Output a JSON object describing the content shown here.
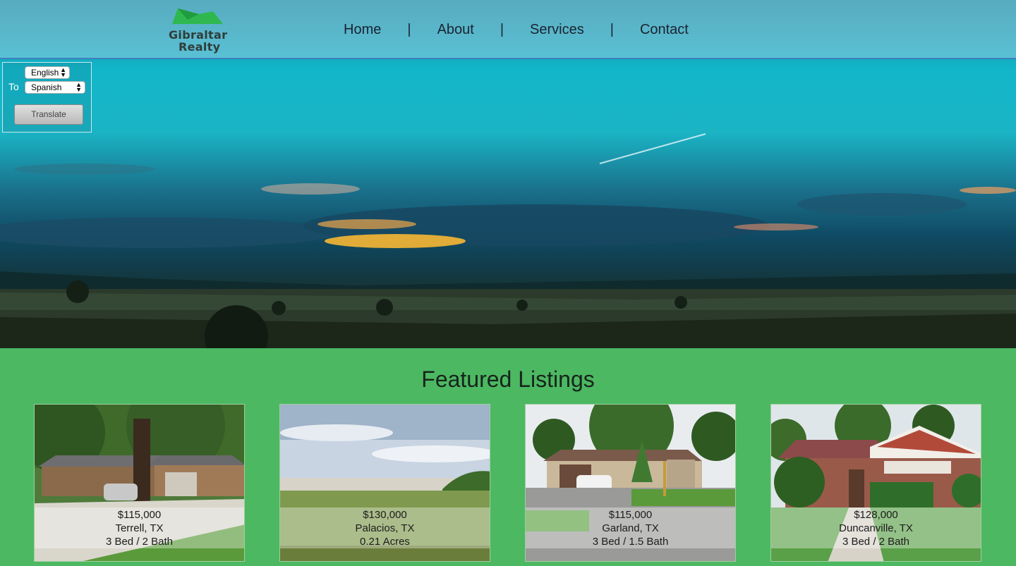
{
  "brand": {
    "logo_line1": "Gibraltar",
    "logo_line2": "Realty",
    "accent_green": "#4cb862"
  },
  "nav": {
    "items": [
      "Home",
      "About",
      "Services",
      "Contact"
    ],
    "separator": "|"
  },
  "translate": {
    "from_value": "English",
    "to_label": "To",
    "to_value": "Spanish",
    "button_label": "Translate"
  },
  "listings": {
    "title": "Featured Listings",
    "cards": [
      {
        "price": "$115,000",
        "location": "Terrell, TX",
        "details": "3 Bed / 2 Bath"
      },
      {
        "price": "$130,000",
        "location": "Palacios, TX",
        "details": "0.21 Acres"
      },
      {
        "price": "$115,000",
        "location": "Garland, TX",
        "details": "3 Bed / 1.5 Bath"
      },
      {
        "price": "$128,000",
        "location": "Duncanville, TX",
        "details": "3 Bed / 2 Bath"
      }
    ]
  }
}
